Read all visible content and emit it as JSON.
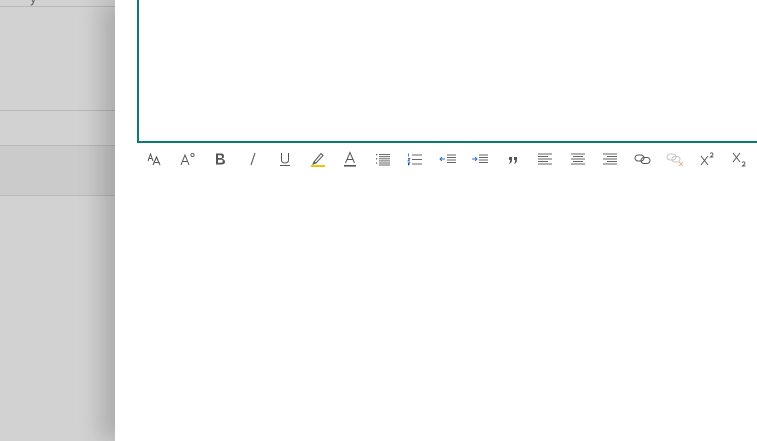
{
  "background": {
    "clipped_text": "y"
  },
  "toolbar": {
    "buttons": [
      {
        "id": "font-size",
        "icon": "font-size-icon",
        "tooltip": ""
      },
      {
        "id": "font-style",
        "icon": "font-style-icon",
        "tooltip": ""
      },
      {
        "id": "bold",
        "icon": "bold-icon",
        "tooltip": ""
      },
      {
        "id": "italic",
        "icon": "italic-icon",
        "tooltip": ""
      },
      {
        "id": "underline",
        "icon": "underline-icon",
        "tooltip": ""
      },
      {
        "id": "highlight",
        "icon": "highlight-icon",
        "tooltip": ""
      },
      {
        "id": "font-color",
        "icon": "font-color-icon",
        "tooltip": ""
      },
      {
        "id": "bullets",
        "icon": "bullet-list-icon",
        "tooltip": ""
      },
      {
        "id": "numbering",
        "icon": "numbered-list-icon",
        "tooltip": ""
      },
      {
        "id": "decrease-indent",
        "icon": "decrease-indent-icon",
        "tooltip": ""
      },
      {
        "id": "increase-indent",
        "icon": "increase-indent-icon",
        "tooltip": ""
      },
      {
        "id": "quote",
        "icon": "quote-icon",
        "tooltip": ""
      },
      {
        "id": "align-left",
        "icon": "align-left-icon",
        "tooltip": ""
      },
      {
        "id": "align-center",
        "icon": "align-center-icon",
        "tooltip": ""
      },
      {
        "id": "align-right",
        "icon": "align-right-icon",
        "tooltip": ""
      },
      {
        "id": "link",
        "icon": "link-icon",
        "tooltip": ""
      },
      {
        "id": "unlink",
        "icon": "unlink-icon",
        "tooltip": ""
      },
      {
        "id": "superscript",
        "icon": "superscript-icon",
        "tooltip": ""
      },
      {
        "id": "subscript",
        "icon": "subscript-icon",
        "tooltip": ""
      }
    ]
  },
  "colors": {
    "accent": "#0b7a75",
    "icon": "#555555",
    "highlight_bar": "#f2c300",
    "indent_arrow": "#2e6fd0",
    "unlink_accent": "#e07a2e"
  }
}
